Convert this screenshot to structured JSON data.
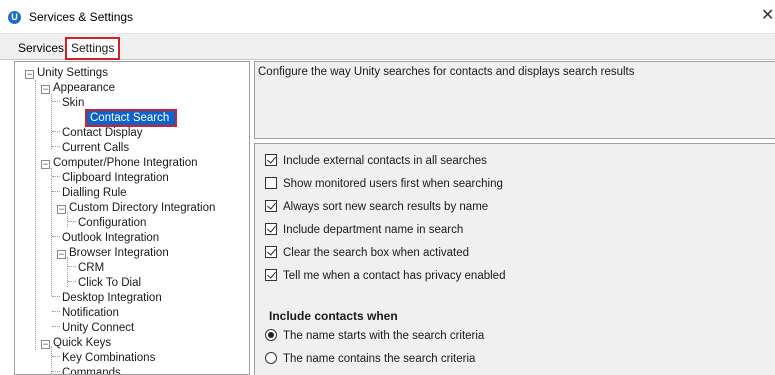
{
  "window": {
    "title": "Services & Settings",
    "icon_letter": "U",
    "close_glyph": "✕"
  },
  "tabs": [
    {
      "label": "Services"
    },
    {
      "label": "Settings",
      "active": true
    }
  ],
  "tree": {
    "items": [
      {
        "label": "Unity Settings",
        "expander": "⊟"
      },
      {
        "label": "Appearance",
        "expander": "⊟"
      },
      {
        "label": "Skin"
      },
      {
        "label": "Contact Search",
        "selected": true
      },
      {
        "label": "Contact Display"
      },
      {
        "label": "Current Calls"
      },
      {
        "label": "Computer/Phone Integration",
        "expander": "⊟"
      },
      {
        "label": "Clipboard Integration"
      },
      {
        "label": "Dialling Rule"
      },
      {
        "label": "Custom Directory Integration",
        "expander": "⊟"
      },
      {
        "label": "Configuration"
      },
      {
        "label": "Outlook Integration"
      },
      {
        "label": "Browser Integration",
        "expander": "⊟"
      },
      {
        "label": "CRM"
      },
      {
        "label": "Click To Dial"
      },
      {
        "label": "Desktop Integration"
      },
      {
        "label": "Notification"
      },
      {
        "label": "Unity Connect"
      },
      {
        "label": "Quick Keys",
        "expander": "⊟"
      },
      {
        "label": "Key Combinations"
      },
      {
        "label": "Commands"
      }
    ]
  },
  "description": "Configure the way Unity searches for contacts and displays search results",
  "options": {
    "checkboxes": [
      {
        "label": "Include external contacts in all searches",
        "checked": true
      },
      {
        "label": "Show monitored users first when searching",
        "checked": false
      },
      {
        "label": "Always sort new search results by name",
        "checked": true
      },
      {
        "label": "Include department name in search",
        "checked": true
      },
      {
        "label": "Clear the search box when activated",
        "checked": true
      },
      {
        "label": "Tell me when a contact has privacy enabled",
        "checked": true
      }
    ],
    "include_heading": "Include contacts when",
    "radios": [
      {
        "label": "The name starts with the search criteria",
        "selected": true
      },
      {
        "label": "The name contains the search criteria",
        "selected": false
      }
    ]
  },
  "colors": {
    "highlight_border": "#d31f2a",
    "selection_bg": "#0a64cf",
    "app_icon": "#1e6fc9"
  }
}
